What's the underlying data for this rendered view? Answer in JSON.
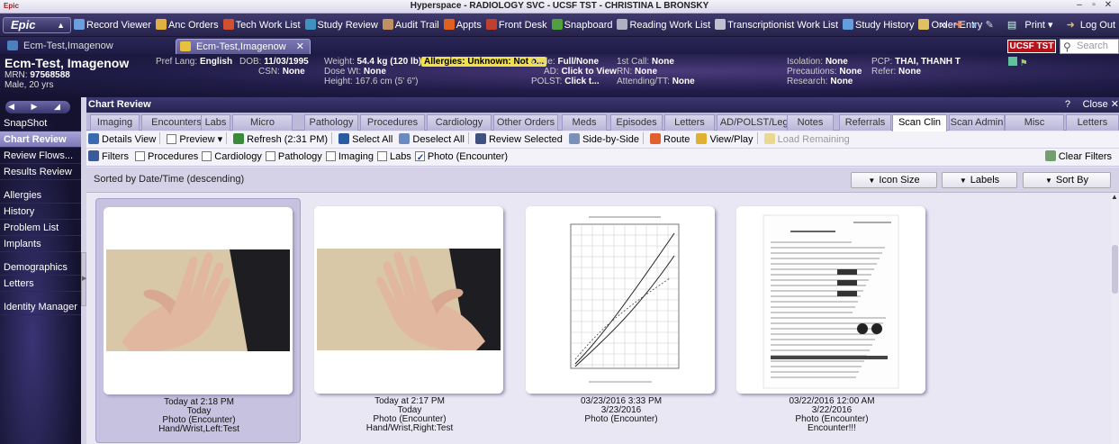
{
  "window": {
    "logo_text": "Epic",
    "title": "Hyperspace - RADIOLOGY SVC - UCSF TST - CHRISTINA L BRONSKY",
    "controls": [
      "–",
      "▫",
      "✕"
    ]
  },
  "epic_toolbar": {
    "epic_button": "Epic",
    "items": [
      {
        "label": "Record Viewer",
        "color": "#6aa0e0"
      },
      {
        "label": "Anc Orders",
        "color": "#e0b040"
      },
      {
        "label": "Tech Work List",
        "color": "#d05030"
      },
      {
        "label": "Study Review",
        "color": "#4090c0"
      },
      {
        "label": "Audit Trail",
        "color": "#c09060"
      },
      {
        "label": "Appts",
        "color": "#e06020"
      },
      {
        "label": "Front Desk",
        "color": "#c04030"
      },
      {
        "label": "Snapboard",
        "color": "#50a040"
      },
      {
        "label": "Reading Work List",
        "color": "#b0b0c0"
      },
      {
        "label": "Transcriptionist Work List",
        "color": "#c0c0d0"
      },
      {
        "label": "Study History",
        "color": "#60a0e0"
      },
      {
        "label": "Order Entry",
        "color": "#e0c060"
      }
    ],
    "more": "››",
    "print_label": "Print",
    "logout_label": "Log Out"
  },
  "patient_tabs": {
    "tab1": "Ecm-Test,Imagenow",
    "tab2": "Ecm-Test,Imagenow",
    "tab2_close": "✕",
    "env_badge": "UCSF TST",
    "search_placeholder": "Search"
  },
  "patient": {
    "name": "Ecm-Test, Imagenow",
    "mrn_label": "MRN:",
    "mrn": "97568588",
    "sex_age": "Male, 20 yrs",
    "pref_lang_label": "Pref Lang:",
    "pref_lang": "English",
    "dob_label": "DOB:",
    "dob": "11/03/1995",
    "csn_label": "CSN:",
    "csn": "None",
    "weight_label": "Weight:",
    "weight": "54.4 kg (120 lb)",
    "dose_wt_label": "Dose Wt:",
    "dose_wt": "None",
    "height_label": "Height:",
    "height": "167.6 cm (5' 6\")",
    "allergies": "Allergies: Unknown: Not o...",
    "code_label": "Code:",
    "code": "Full/None",
    "ad_label": "AD:",
    "ad": "Click to View",
    "polst_label": "POLST:",
    "polst": "Click t...",
    "first_call_label": "1st Call:",
    "first_call": "None",
    "rn_label": "RN:",
    "rn": "None",
    "attending_label": "Attending/TT:",
    "attending": "None",
    "isolation_label": "Isolation:",
    "isolation": "None",
    "precautions_label": "Precautions:",
    "precautions": "None",
    "research_label": "Research:",
    "research": "None",
    "pcp_label": "PCP:",
    "pcp": "THAI, THANH T",
    "refer_label": "Refer:",
    "refer": "None"
  },
  "sidebar": {
    "arrows": "◀ ▶ ◢",
    "items": [
      {
        "label": "SnapShot"
      },
      {
        "label": "Chart Review"
      },
      {
        "label": "Review Flows..."
      },
      {
        "label": "Results Review"
      },
      {
        "label": "Allergies"
      },
      {
        "label": "History"
      },
      {
        "label": "Problem List"
      },
      {
        "label": "Implants"
      },
      {
        "label": "Demographics"
      },
      {
        "label": "Letters"
      },
      {
        "label": "Identity Manager"
      }
    ]
  },
  "chart_review": {
    "title": "Chart Review",
    "help": "?",
    "close": "Close ✕",
    "tabs": [
      {
        "label": "Imaging"
      },
      {
        "label": "Encounters"
      },
      {
        "label": "Labs"
      },
      {
        "label": "Micro"
      },
      {
        "label": "Pathology"
      },
      {
        "label": "Procedures"
      },
      {
        "label": "Cardiology"
      },
      {
        "label": "Other Orders"
      },
      {
        "label": "Meds"
      },
      {
        "label": "Episodes"
      },
      {
        "label": "Letters"
      },
      {
        "label": "AD/POLST/Legal"
      },
      {
        "label": "Notes"
      },
      {
        "label": "Referrals"
      },
      {
        "label": "Scan Clin"
      },
      {
        "label": "Scan Admin"
      },
      {
        "label": "Misc Reports"
      },
      {
        "label": "Letters"
      }
    ],
    "active_tab": "Scan Clin",
    "toolbar": {
      "details_view": "Details View",
      "preview": "Preview",
      "preview_caret": "▾",
      "refresh": "Refresh (2:31 PM)",
      "select_all": "Select All",
      "deselect_all": "Deselect All",
      "review_selected": "Review Selected",
      "side_by_side": "Side-by-Side",
      "route": "Route",
      "view_play": "View/Play",
      "load_remaining": "Load Remaining"
    },
    "filters": {
      "label": "Filters",
      "options": [
        {
          "label": "Procedures",
          "checked": false
        },
        {
          "label": "Cardiology",
          "checked": false
        },
        {
          "label": "Pathology",
          "checked": false
        },
        {
          "label": "Imaging",
          "checked": false
        },
        {
          "label": "Labs",
          "checked": false
        },
        {
          "label": "Photo (Encounter)",
          "checked": true
        }
      ],
      "clear": "Clear Filters"
    },
    "sort_text": "Sorted by Date/Time (descending)",
    "icon_size": "Icon Size",
    "labels": "Labels",
    "sort_by": "Sort By",
    "cards": [
      {
        "line1": "Today at 2:18 PM",
        "line2": "Today",
        "line3": "Photo (Encounter)",
        "line4": "Hand/Wrist,Left:Test",
        "kind": "photo",
        "selected": true
      },
      {
        "line1": "Today at 2:17 PM",
        "line2": "Today",
        "line3": "Photo (Encounter)",
        "line4": "Hand/Wrist,Right:Test",
        "kind": "photo",
        "selected": false
      },
      {
        "line1": "03/23/2016 3:33 PM",
        "line2": "3/23/2016",
        "line3": "Photo (Encounter)",
        "line4": "",
        "kind": "chart",
        "selected": false
      },
      {
        "line1": "03/22/2016 12:00 AM",
        "line2": "3/22/2016",
        "line3": "Photo (Encounter)",
        "line4": "Encounter!!!",
        "kind": "document",
        "selected": false
      }
    ]
  }
}
